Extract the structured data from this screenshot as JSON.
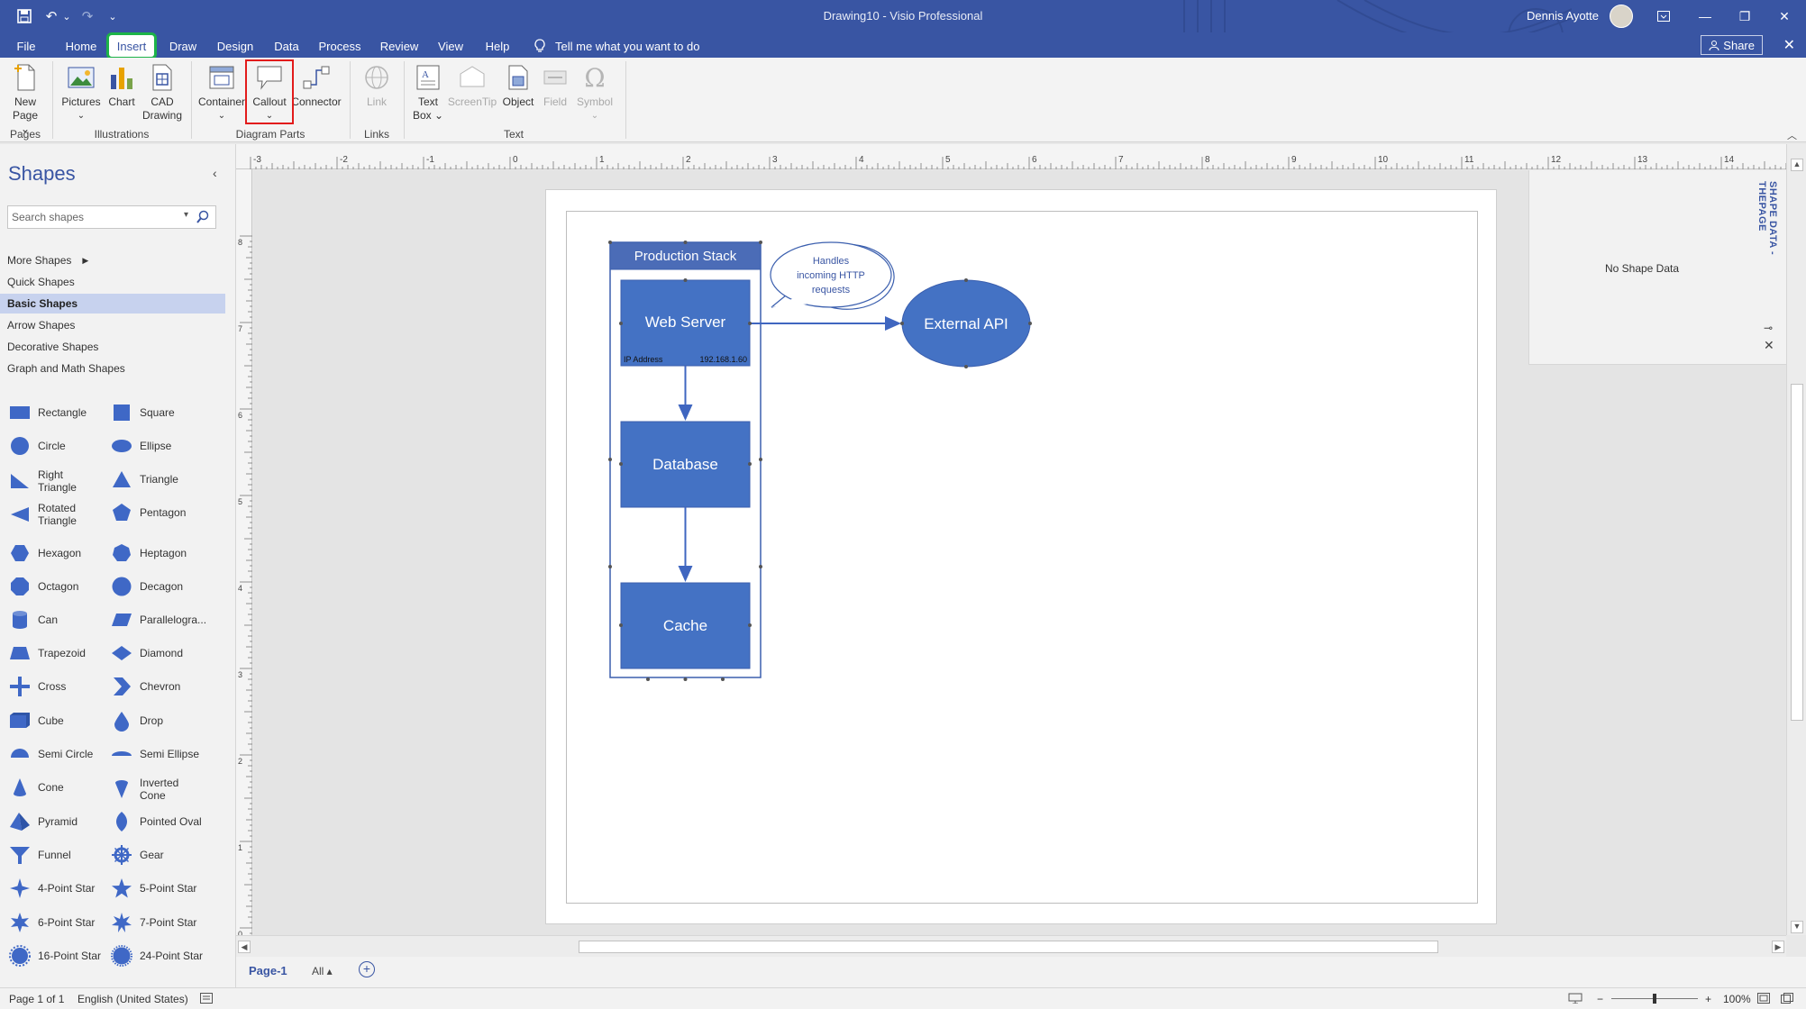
{
  "window": {
    "title": "Drawing10  -  Visio Professional",
    "user": "Dennis Ayotte",
    "minimize": "—",
    "restore": "❐",
    "close": "✕"
  },
  "qat": {
    "save": "💾",
    "undo": "↶",
    "undo_more": "⌄",
    "redo": "↷",
    "customize": "⌄"
  },
  "tabs": [
    "File",
    "Home",
    "Insert",
    "Draw",
    "Design",
    "Data",
    "Process",
    "Review",
    "View",
    "Help"
  ],
  "active_tab": "Insert",
  "tell_me": "Tell me what you want to do",
  "share": "Share",
  "ribbon": {
    "new_page": "New",
    "new_page_2": "Page ⌄",
    "pictures": "Pictures",
    "chart": "Chart",
    "cad_1": "CAD",
    "cad_2": "Drawing",
    "container": "Container",
    "callout": "Callout",
    "connector": "Connector",
    "link": "Link",
    "text_box_1": "Text",
    "text_box_2": "Box ⌄",
    "screentip": "ScreenTip",
    "object": "Object",
    "field": "Field",
    "symbol": "Symbol",
    "groups": {
      "pages": "Pages",
      "illustrations": "Illustrations",
      "diagram_parts": "Diagram Parts",
      "links": "Links",
      "text": "Text"
    }
  },
  "shapes_pane": {
    "title": "Shapes",
    "search_placeholder": "Search shapes",
    "nav": [
      "More Shapes",
      "Quick Shapes",
      "Basic Shapes",
      "Arrow Shapes",
      "Decorative Shapes",
      "Graph and Math Shapes"
    ],
    "selected": "Basic Shapes",
    "stencils": [
      [
        "Rectangle",
        "Square"
      ],
      [
        "Circle",
        "Ellipse"
      ],
      [
        "Right\nTriangle",
        "Triangle"
      ],
      [
        "Rotated\nTriangle",
        "Pentagon"
      ],
      [
        "Hexagon",
        "Heptagon"
      ],
      [
        "Octagon",
        "Decagon"
      ],
      [
        "Can",
        "Parallelogra..."
      ],
      [
        "Trapezoid",
        "Diamond"
      ],
      [
        "Cross",
        "Chevron"
      ],
      [
        "Cube",
        "Drop"
      ],
      [
        "Semi Circle",
        "Semi Ellipse"
      ],
      [
        "Cone",
        "Inverted\nCone"
      ],
      [
        "Pyramid",
        "Pointed Oval"
      ],
      [
        "Funnel",
        "Gear"
      ],
      [
        "4-Point Star",
        "5-Point Star"
      ],
      [
        "6-Point Star",
        "7-Point Star"
      ],
      [
        "16-Point Star",
        "24-Point Star"
      ]
    ]
  },
  "ruler": {
    "h": [
      "-3",
      "-2",
      "-1",
      "0",
      "1",
      "2",
      "3",
      "4",
      "5",
      "6",
      "7",
      "8",
      "9",
      "10",
      "11",
      "12",
      "13",
      "14"
    ],
    "v": [
      "8",
      "7",
      "6",
      "5",
      "4",
      "3",
      "2",
      "1",
      "0"
    ]
  },
  "diagram": {
    "container_title": "Production Stack",
    "web_server": "Web Server",
    "ip_label": "IP Address",
    "ip_value": "192.168.1.60",
    "database": "Database",
    "cache": "Cache",
    "external_api": "External API",
    "callout_line1": "Handles",
    "callout_line2": "incoming HTTP",
    "callout_line3": "requests",
    "colors": {
      "fill": "#4472c4",
      "title_fill": "#4b6cb7",
      "stroke": "#3b5fae",
      "connector": "#3f66c0"
    }
  },
  "shape_data": {
    "title": "SHAPE DATA - THEPAGE",
    "empty": "No Shape Data"
  },
  "page_tabs": {
    "current": "Page-1",
    "all": "All ▴",
    "add": "+"
  },
  "status": {
    "page": "Page 1 of 1",
    "language": "English (United States)",
    "zoom": "100%"
  },
  "theme": {
    "accent": "#3955a3",
    "insert_highlight": "#1db348",
    "callout_highlight": "#e21b1b"
  }
}
